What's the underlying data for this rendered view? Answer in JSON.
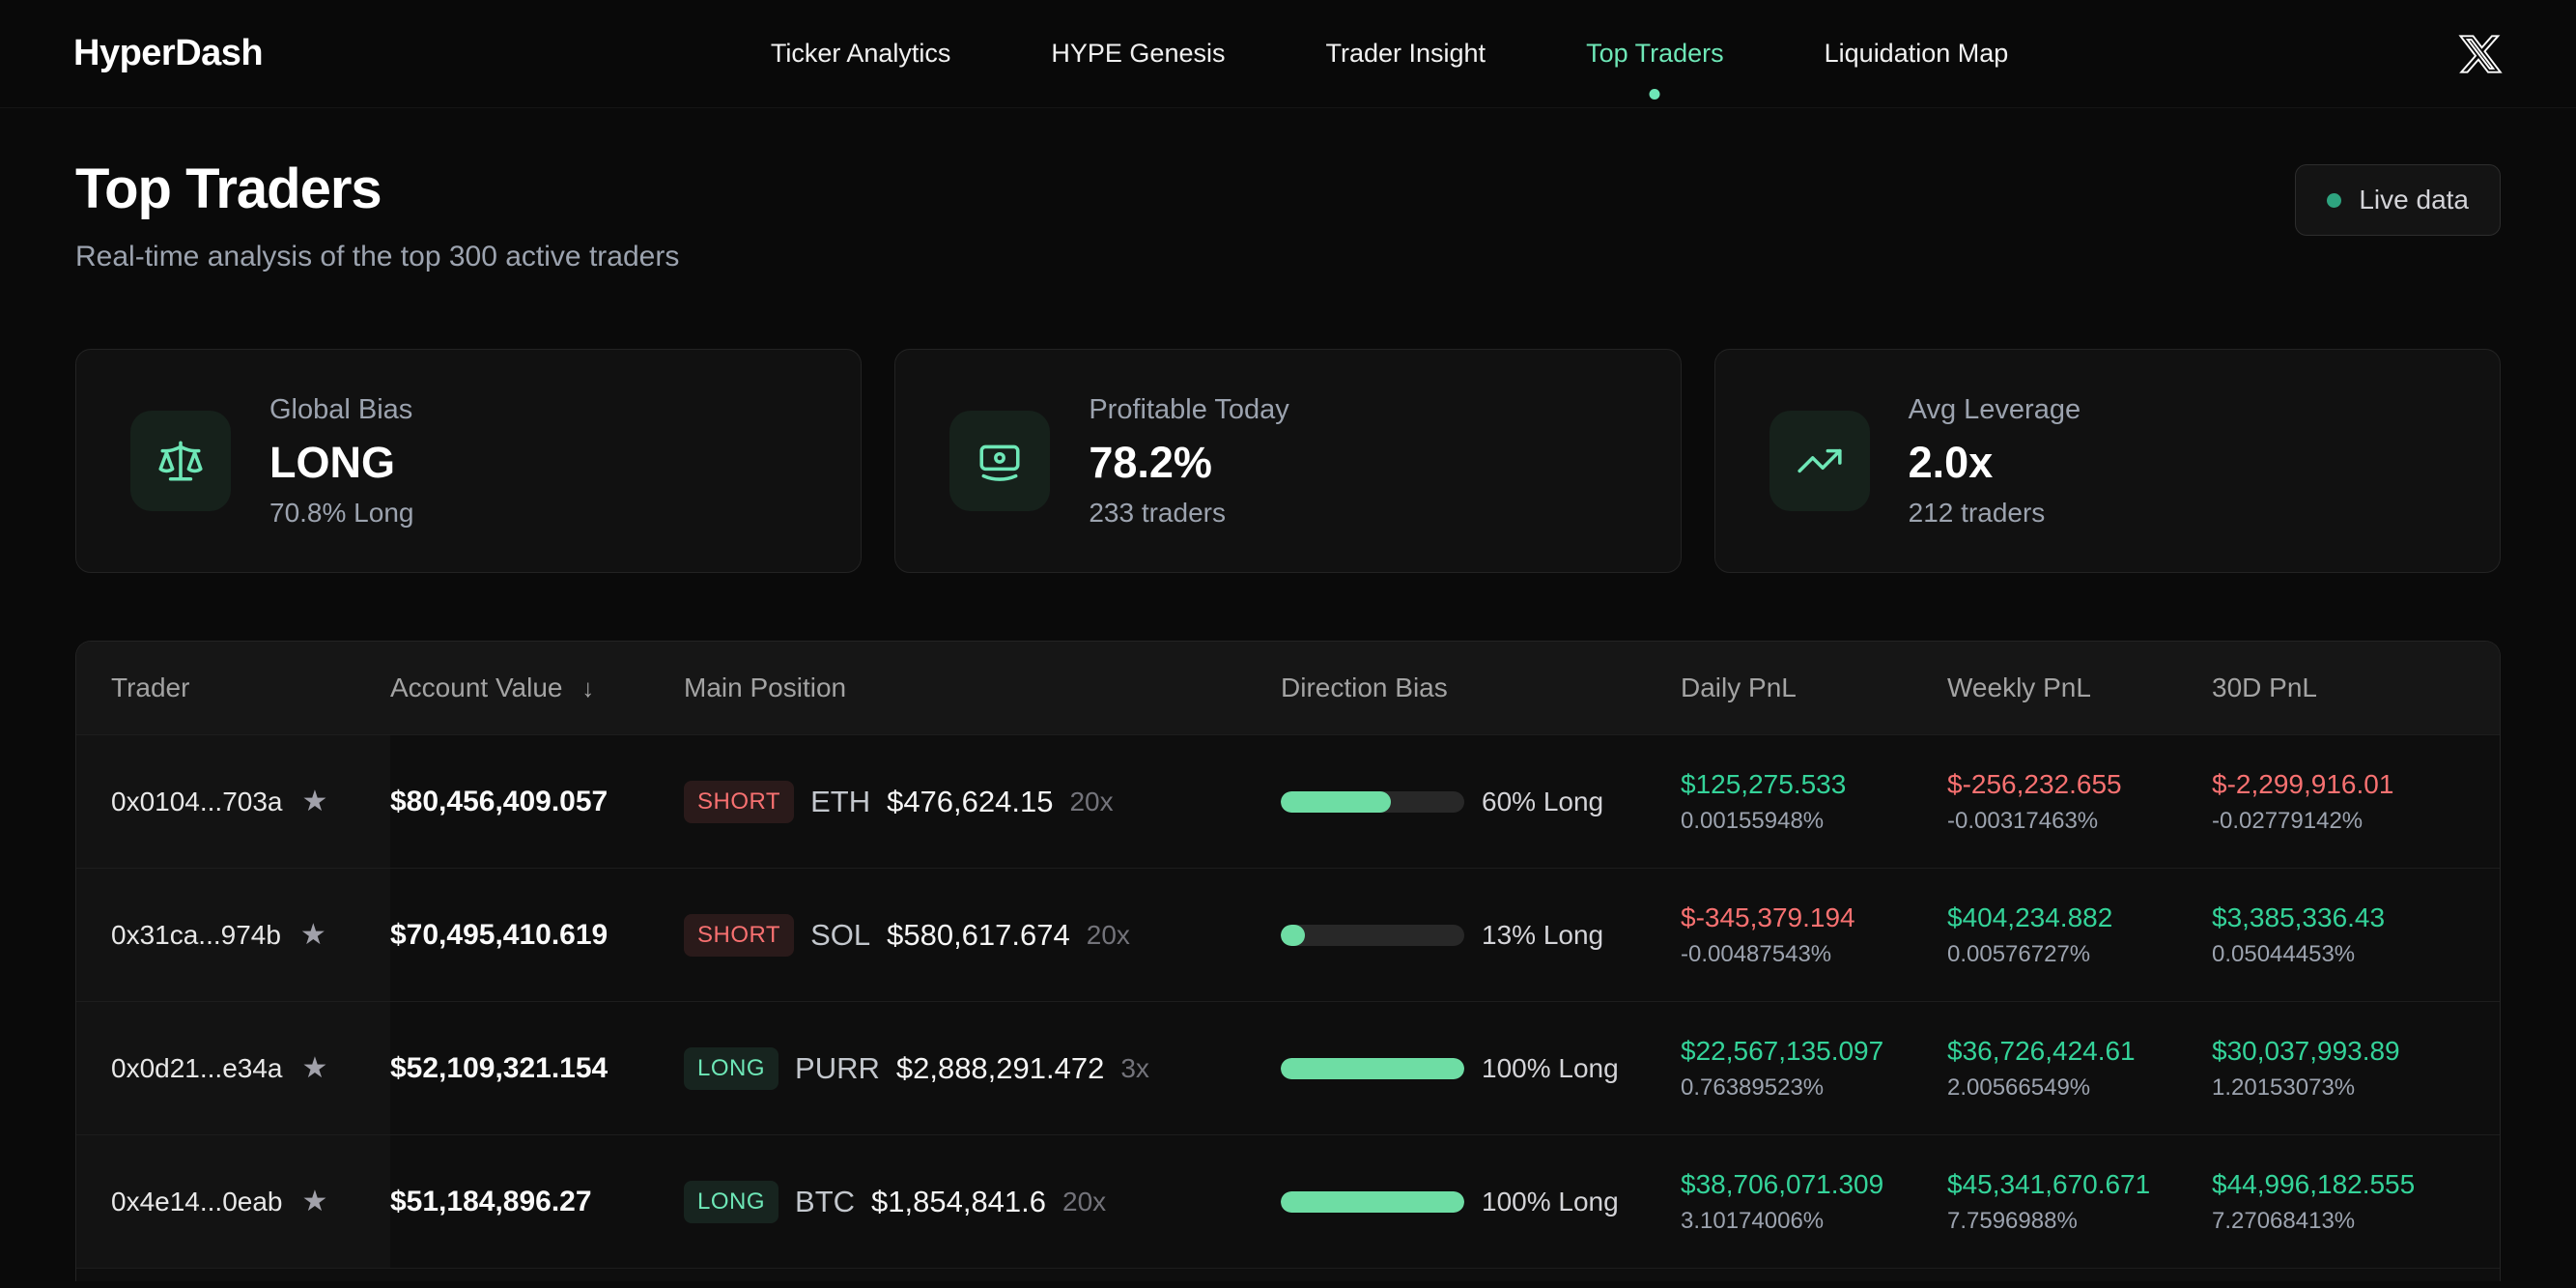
{
  "colors": {
    "accent_green": "#6ee7b7",
    "positive_text": "#34d399",
    "negative_text": "#f87171",
    "bar_fill": "#6edda4",
    "live_dot": "#2ea37f",
    "background": "#0a0a0a"
  },
  "header": {
    "logo": "HyperDash",
    "nav": [
      {
        "label": "Ticker Analytics",
        "active": false
      },
      {
        "label": "HYPE Genesis",
        "active": false
      },
      {
        "label": "Trader Insight",
        "active": false
      },
      {
        "label": "Top Traders",
        "active": true
      },
      {
        "label": "Liquidation Map",
        "active": false
      }
    ],
    "social_icon": "x-logo-icon"
  },
  "page": {
    "title": "Top Traders",
    "subtitle": "Real-time analysis of the top 300 active traders",
    "live_badge_label": "Live data"
  },
  "stats": [
    {
      "icon": "scale-icon",
      "label": "Global Bias",
      "value": "LONG",
      "sub": "70.8% Long"
    },
    {
      "icon": "banknote-icon",
      "label": "Profitable Today",
      "value": "78.2%",
      "sub": "233 traders"
    },
    {
      "icon": "trending-up-icon",
      "label": "Avg Leverage",
      "value": "2.0x",
      "sub": "212 traders"
    }
  ],
  "table": {
    "columns": [
      "Trader",
      "Account Value",
      "Main Position",
      "Direction Bias",
      "Daily PnL",
      "Weekly PnL",
      "30D PnL"
    ],
    "sort_glyph": "↓",
    "star_glyph": "★",
    "rows": [
      {
        "trader": "0x0104...703a",
        "account_value": "$80,456,409.057",
        "position": {
          "side": "SHORT",
          "coin": "ETH",
          "value": "$476,624.15",
          "leverage": "20x"
        },
        "bias": {
          "pct": 60,
          "label": "60% Long"
        },
        "daily": {
          "value": "$125,275.533",
          "pct": "0.00155948%",
          "tone": "pos"
        },
        "weekly": {
          "value": "$-256,232.655",
          "pct": "-0.00317463%",
          "tone": "neg"
        },
        "monthly": {
          "value": "$-2,299,916.01",
          "pct": "-0.02779142%",
          "tone": "neg"
        }
      },
      {
        "trader": "0x31ca...974b",
        "account_value": "$70,495,410.619",
        "position": {
          "side": "SHORT",
          "coin": "SOL",
          "value": "$580,617.674",
          "leverage": "20x"
        },
        "bias": {
          "pct": 13,
          "label": "13% Long"
        },
        "daily": {
          "value": "$-345,379.194",
          "pct": "-0.00487543%",
          "tone": "neg"
        },
        "weekly": {
          "value": "$404,234.882",
          "pct": "0.00576727%",
          "tone": "pos"
        },
        "monthly": {
          "value": "$3,385,336.43",
          "pct": "0.05044453%",
          "tone": "pos"
        }
      },
      {
        "trader": "0x0d21...e34a",
        "account_value": "$52,109,321.154",
        "position": {
          "side": "LONG",
          "coin": "PURR",
          "value": "$2,888,291.472",
          "leverage": "3x"
        },
        "bias": {
          "pct": 100,
          "label": "100% Long"
        },
        "daily": {
          "value": "$22,567,135.097",
          "pct": "0.76389523%",
          "tone": "pos"
        },
        "weekly": {
          "value": "$36,726,424.61",
          "pct": "2.00566549%",
          "tone": "pos"
        },
        "monthly": {
          "value": "$30,037,993.89",
          "pct": "1.20153073%",
          "tone": "pos"
        }
      },
      {
        "trader": "0x4e14...0eab",
        "account_value": "$51,184,896.27",
        "position": {
          "side": "LONG",
          "coin": "BTC",
          "value": "$1,854,841.6",
          "leverage": "20x"
        },
        "bias": {
          "pct": 100,
          "label": "100% Long"
        },
        "daily": {
          "value": "$38,706,071.309",
          "pct": "3.10174006%",
          "tone": "pos"
        },
        "weekly": {
          "value": "$45,341,670.671",
          "pct": "7.7596988%",
          "tone": "pos"
        },
        "monthly": {
          "value": "$44,996,182.555",
          "pct": "7.27068413%",
          "tone": "pos"
        }
      }
    ]
  }
}
